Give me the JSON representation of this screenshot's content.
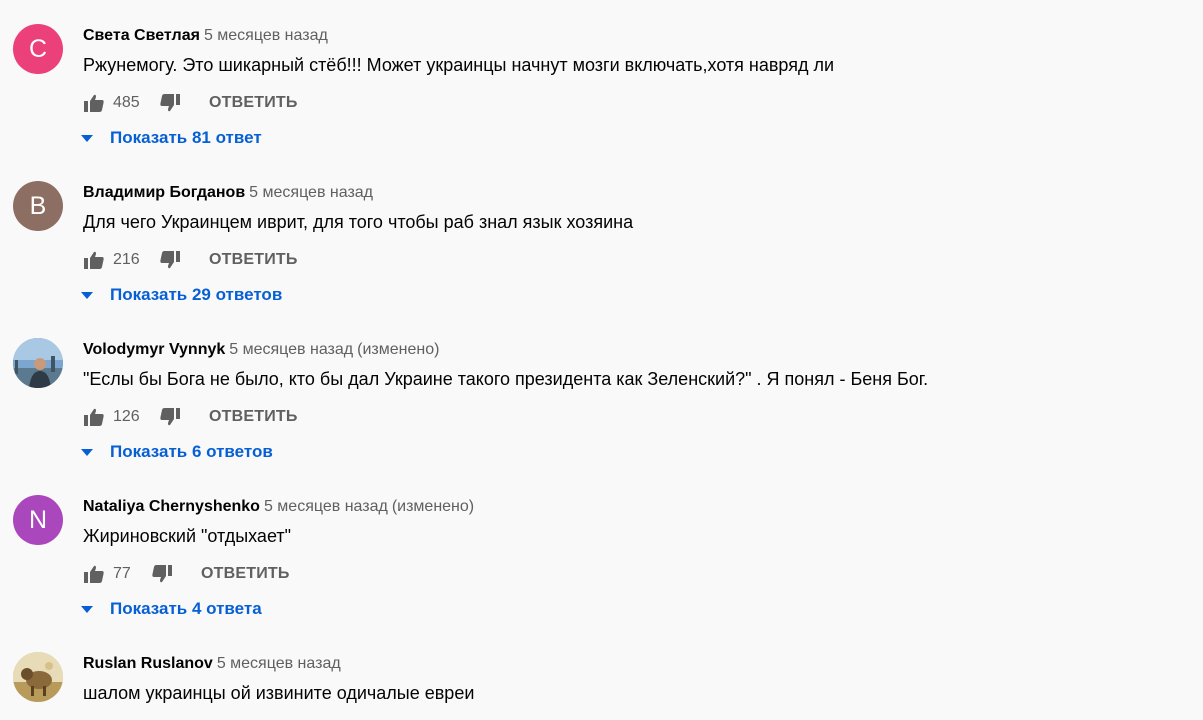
{
  "comments": [
    {
      "avatar_letter": "С",
      "avatar_color": "#ec407a",
      "author": "Света Светлая",
      "time": "5 месяцев назад",
      "edited": "",
      "text": "Ржунемогу. Это шикарный стёб!!! Может украинцы начнут мозги включать,хотя навряд ли",
      "likes": "485",
      "reply_label": "ОТВЕТИТЬ",
      "replies_label": "Показать 81 ответ"
    },
    {
      "avatar_letter": "В",
      "avatar_color": "#8d6e63",
      "author": "Владимир Богданов",
      "time": "5 месяцев назад",
      "edited": "",
      "text": "Для чего Украинцем иврит, для того чтобы раб знал язык хозяина",
      "likes": "216",
      "reply_label": "ОТВЕТИТЬ",
      "replies_label": "Показать 29 ответов"
    },
    {
      "avatar_letter": "",
      "avatar_color": "#6d8fb3",
      "author": "Volodymyr Vynnyk",
      "time": "5 месяцев назад",
      "edited": "(изменено)",
      "text": "\"Еслы бы Бога не было, кто бы дал Украине такого президента как Зеленский?\" . Я понял - Беня Бог.",
      "likes": "126",
      "reply_label": "ОТВЕТИТЬ",
      "replies_label": "Показать 6 ответов"
    },
    {
      "avatar_letter": "N",
      "avatar_color": "#ab47bc",
      "author": "Nataliya Chernyshenko",
      "time": "5 месяцев назад",
      "edited": "(изменено)",
      "text": "Жириновский  \"отдыхает\"",
      "likes": "77",
      "reply_label": "ОТВЕТИТЬ",
      "replies_label": "Показать 4 ответа"
    },
    {
      "avatar_letter": "",
      "avatar_color": "#c9b47a",
      "author": "Ruslan Ruslanov",
      "time": "5 месяцев назад",
      "edited": "",
      "text": "шалом украинцы ой извините одичалые евреи",
      "likes": "",
      "reply_label": "",
      "replies_label": ""
    }
  ],
  "icons": {
    "like": "thumb-up-icon",
    "dislike": "thumb-down-icon",
    "expand": "caret-down-icon"
  },
  "colors": {
    "link": "#065fd4",
    "secondary": "#606060",
    "background": "#f9f9f9"
  }
}
